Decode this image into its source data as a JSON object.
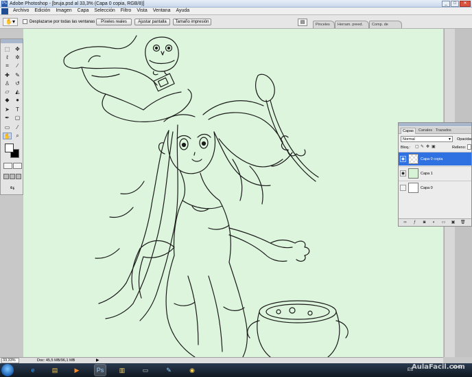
{
  "window": {
    "title": "Adobe Photoshop - [bruja.psd al 33,3% (Capa 0 copia, RGB/8)]",
    "minimize": "_",
    "maximize": "□",
    "close": "✕"
  },
  "menu": {
    "items": [
      "Archivo",
      "Edición",
      "Imagen",
      "Capa",
      "Selección",
      "Filtro",
      "Vista",
      "Ventana",
      "Ayuda"
    ]
  },
  "options": {
    "scroll_all_label": "Desplazarse por todas las ventanas",
    "btn_actual_pixels": "Píxeles reales",
    "btn_fit_screen": "Ajustar pantalla",
    "btn_print_size": "Tamaño impresión",
    "dock_tabs": [
      "Pinceles",
      "Herram. preed.",
      "Comp. de capas"
    ]
  },
  "layers_panel": {
    "tabs": [
      "Capas",
      "Canales",
      "Trazados"
    ],
    "blend_mode": "Normal",
    "opacity_label": "Opacidad:",
    "lock_label": "Bloq.:",
    "fill_label": "Relleno:",
    "layers": [
      {
        "name": "Capa 0 copia",
        "selected": true,
        "visible": true
      },
      {
        "name": "Capa 1",
        "selected": false,
        "visible": true
      },
      {
        "name": "Capa 0",
        "selected": false,
        "visible": false
      }
    ]
  },
  "status": {
    "zoom": "33,33%",
    "doc": "Doc: 45,5 MB/96,1 MB"
  },
  "taskbar": {
    "language": "ES",
    "time": "10:43",
    "watermark": "AulaFacil.com"
  },
  "colors": {
    "canvas_bg": "#dcf5dc",
    "selected_layer": "#2f71e0",
    "ink": "#1a1a1a"
  }
}
